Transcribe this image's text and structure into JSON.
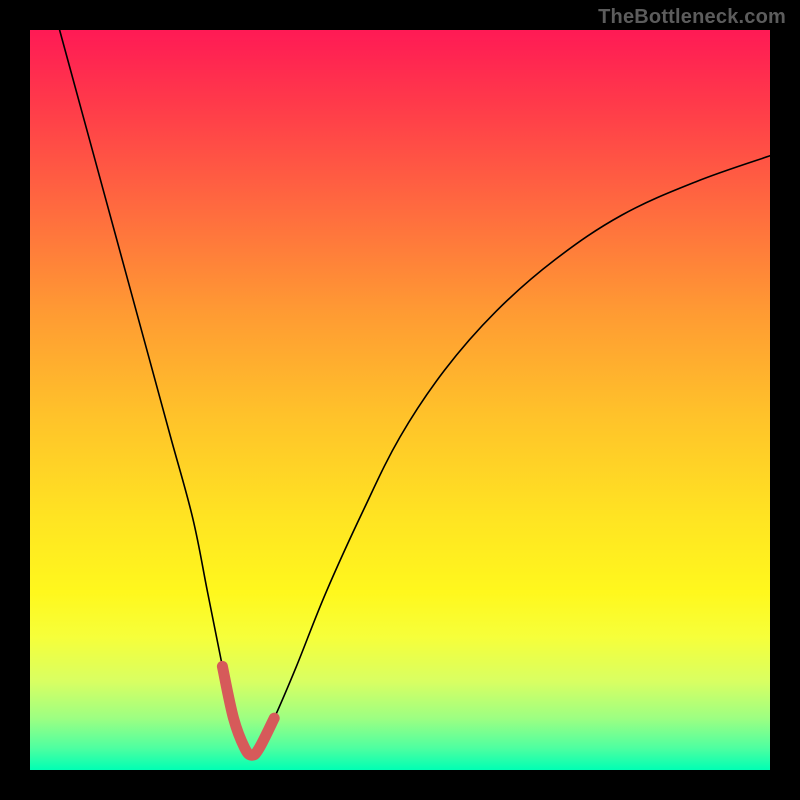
{
  "watermark": "TheBottleneck.com",
  "chart_data": {
    "type": "line",
    "title": "",
    "xlabel": "",
    "ylabel": "",
    "xlim": [
      0,
      100
    ],
    "ylim": [
      0,
      100
    ],
    "grid": false,
    "legend": false,
    "series": [
      {
        "name": "bottleneck-curve",
        "x": [
          4,
          7,
          10,
          13,
          16,
          19,
          22,
          24,
          26,
          27.5,
          29,
          30,
          31,
          33,
          36,
          40,
          45,
          50,
          56,
          63,
          71,
          80,
          90,
          100
        ],
        "y": [
          100,
          89,
          78,
          67,
          56,
          45,
          34,
          24,
          14,
          7,
          3,
          2,
          3,
          7,
          14,
          24,
          35,
          45,
          54,
          62,
          69,
          75,
          79.5,
          83
        ]
      },
      {
        "name": "optimal-range-highlight",
        "x": [
          26,
          27.5,
          29,
          30,
          31,
          33
        ],
        "y": [
          14,
          7,
          3,
          2,
          3,
          7
        ]
      }
    ],
    "colors": {
      "curve": "#000000",
      "highlight": "#d65a5a"
    }
  }
}
